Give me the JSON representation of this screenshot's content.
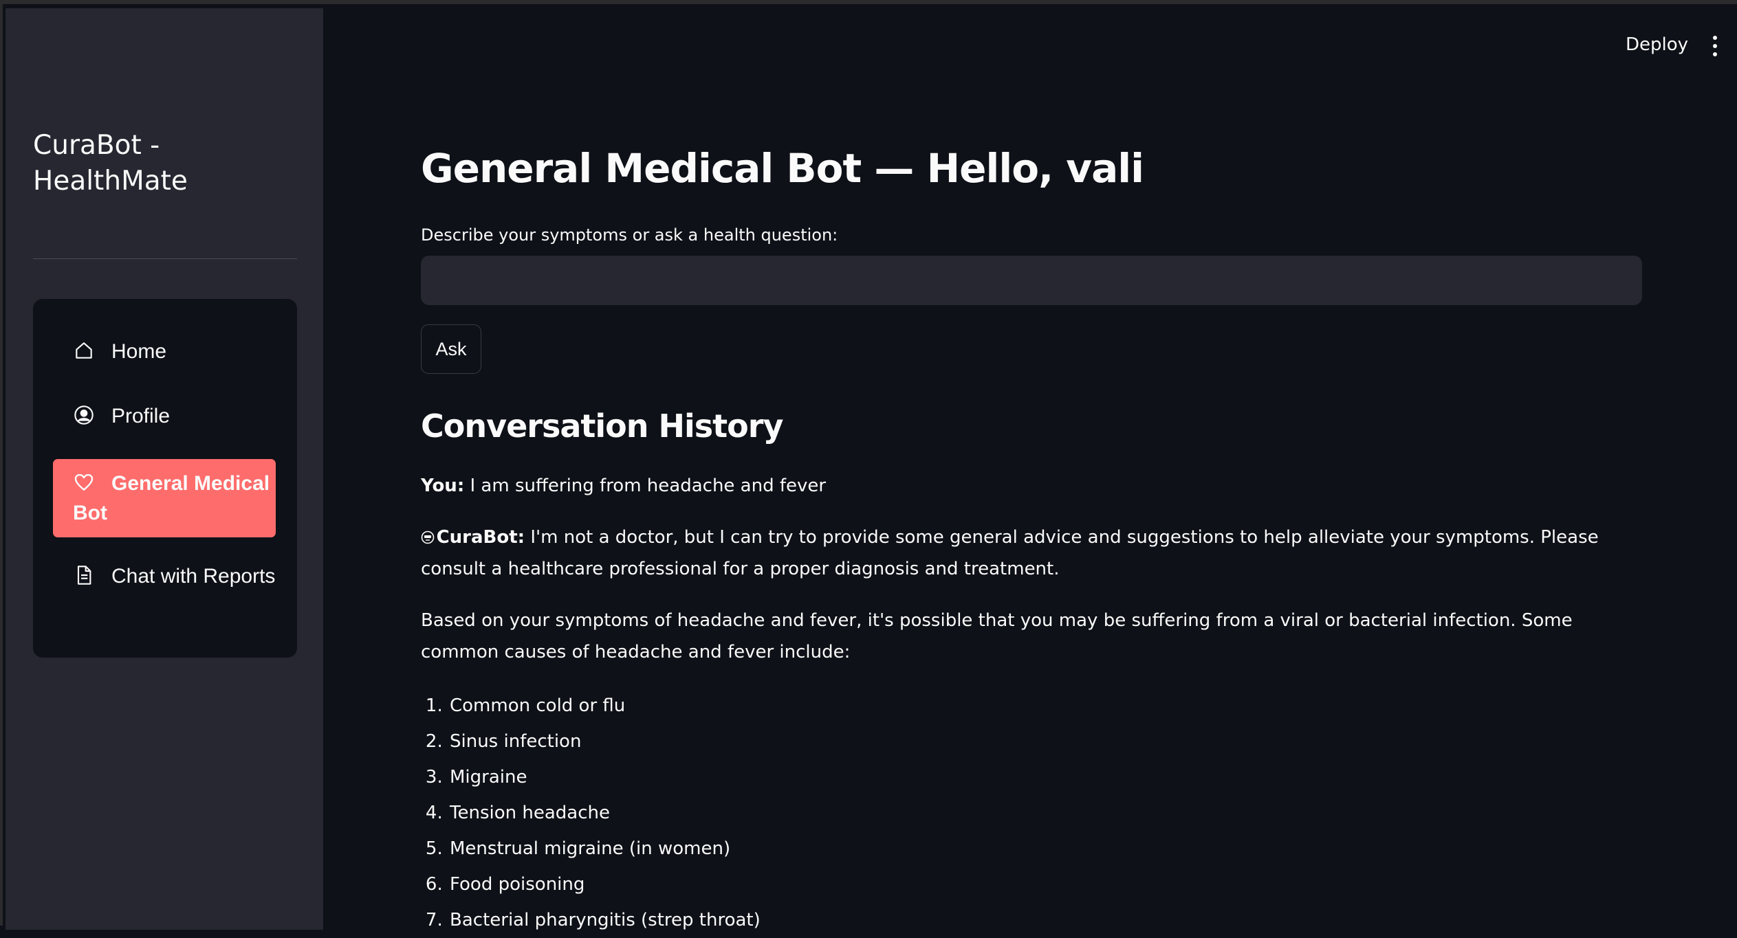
{
  "sidebar": {
    "title": "CuraBot - HealthMate",
    "nav": [
      {
        "label": "Home",
        "icon": "home-icon"
      },
      {
        "label": "Profile",
        "icon": "user-circle-icon"
      },
      {
        "label": "General Medical Bot",
        "icon": "heart-icon",
        "active": true
      },
      {
        "label": "Chat with Reports",
        "icon": "document-icon"
      }
    ],
    "active_color": "#ff6c6c"
  },
  "header": {
    "deploy_label": "Deploy",
    "menu_icon": "kebab-menu-icon"
  },
  "main": {
    "title": "General Medical Bot — Hello, vali",
    "input_label": "Describe your symptoms or ask a health question:",
    "input_value": "",
    "ask_label": "Ask",
    "history_title": "Conversation History",
    "messages": {
      "user_prefix": "You:",
      "user_text": " I am suffering from headache and fever",
      "bot_prefix": "CuraBot:",
      "bot_intro": " I'm not a doctor, but I can try to provide some general advice and suggestions to help alleviate your symptoms. Please consult a healthcare professional for a proper diagnosis and treatment.",
      "bot_para2": "Based on your symptoms of headache and fever, it's possible that you may be suffering from a viral or bacterial infection. Some common causes of headache and fever include:",
      "causes": [
        "Common cold or flu",
        "Sinus infection",
        "Migraine",
        "Tension headache",
        "Menstrual migraine (in women)",
        "Food poisoning",
        "Bacterial pharyngitis (strep throat)"
      ]
    }
  },
  "colors": {
    "background": "#0e1117",
    "sidebar": "#262730",
    "input": "#262730",
    "accent": "#ff6c6c"
  }
}
